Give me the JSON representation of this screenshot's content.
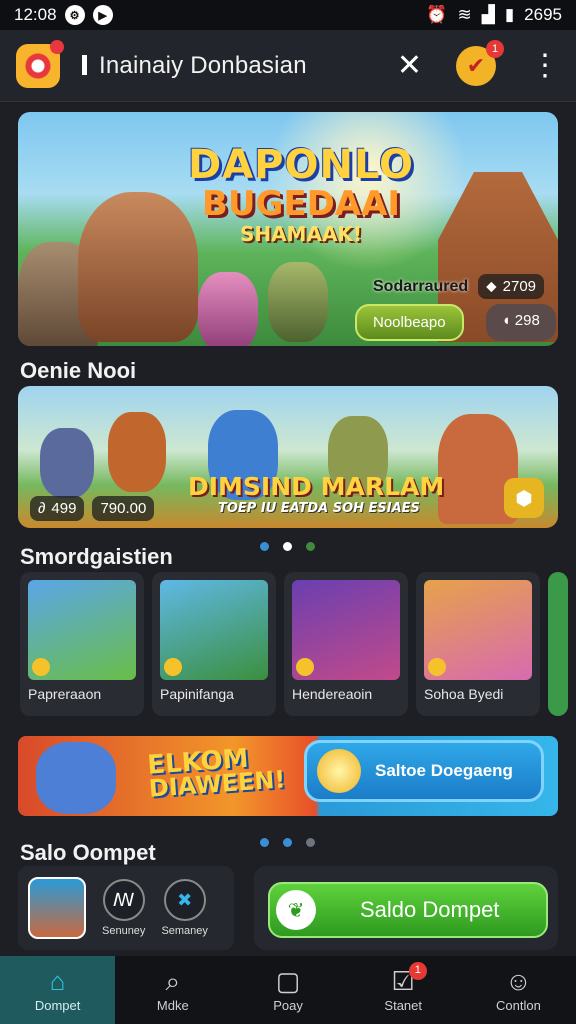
{
  "status_bar": {
    "time": "12:08",
    "right_text": "2695"
  },
  "app_bar": {
    "title": "Inainaiy Donbasian",
    "notification_count": "1"
  },
  "hero": {
    "title_line1": "DAPONLO",
    "title_line2": "BUGEDAAI",
    "title_line3": "SHAMAAK!",
    "subtitle": "Sodarraured",
    "stat": "2709",
    "button_primary": "Noolbeapo",
    "button_secondary": "298"
  },
  "section1": {
    "title": "Oenie Nooi"
  },
  "banner2": {
    "title": "DIMSIND MARLAM",
    "subtitle": "TOEP IU EATDA SOH ESIAES",
    "pill1": "499",
    "pill2": "790.00"
  },
  "section2": {
    "title": "Smordgaistien"
  },
  "cards": [
    {
      "label": "Papreraaon",
      "color1": "#5aa6e8",
      "color2": "#6abe48"
    },
    {
      "label": "Papinifanga",
      "color1": "#5fb8e6",
      "color2": "#3b8f3e"
    },
    {
      "label": "Hendereaoin",
      "color1": "#6a3fb0",
      "color2": "#c24a8a"
    },
    {
      "label": "Sohoa Byedi",
      "color1": "#e6a24a",
      "color2": "#d86ab0"
    }
  ],
  "promo": {
    "title_line1": "ELKOM",
    "title_line2": "DIAWEEN!",
    "cta": "Saltoe Doegaeng"
  },
  "section3": {
    "title": "Salo Oompet"
  },
  "wallet": {
    "opt1": "Senuney",
    "opt2": "Semaney",
    "button": "Saldo Dompet"
  },
  "bottom_nav": [
    {
      "label": "Dompet",
      "icon": "home-icon",
      "active": true
    },
    {
      "label": "Mdke",
      "icon": "search-icon",
      "active": false
    },
    {
      "label": "Poay",
      "icon": "bag-icon",
      "active": false
    },
    {
      "label": "Stanet",
      "icon": "inbox-icon",
      "active": false,
      "badge": "1"
    },
    {
      "label": "Contlon",
      "icon": "profile-icon",
      "active": false
    }
  ],
  "colors": {
    "background": "#1d1f24",
    "accent_teal": "#2bc8de",
    "accent_green": "#2e9a1f",
    "badge_red": "#e53935"
  }
}
